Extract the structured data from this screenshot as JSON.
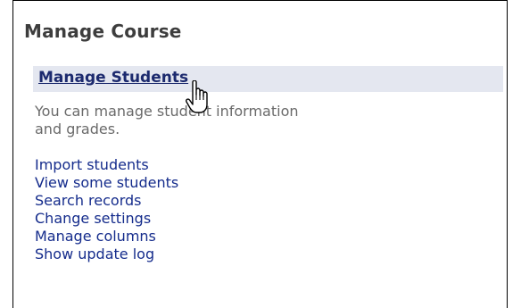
{
  "panel": {
    "title": "Manage Course",
    "section": {
      "link_label": "Manage Students",
      "description": "You can manage student information and grades."
    },
    "links": [
      {
        "label": "Import students"
      },
      {
        "label": "View some students"
      },
      {
        "label": "Search records"
      },
      {
        "label": "Change settings"
      },
      {
        "label": "Manage columns"
      },
      {
        "label": "Show update log"
      }
    ]
  },
  "cursor": {
    "icon": "hand-pointer-icon"
  },
  "colors": {
    "title_text": "#3d3d3d",
    "section_header_bg": "#e4e7f0",
    "section_link": "#1c2a6e",
    "description_text": "#6a6a6a",
    "link_text": "#152c8c"
  }
}
